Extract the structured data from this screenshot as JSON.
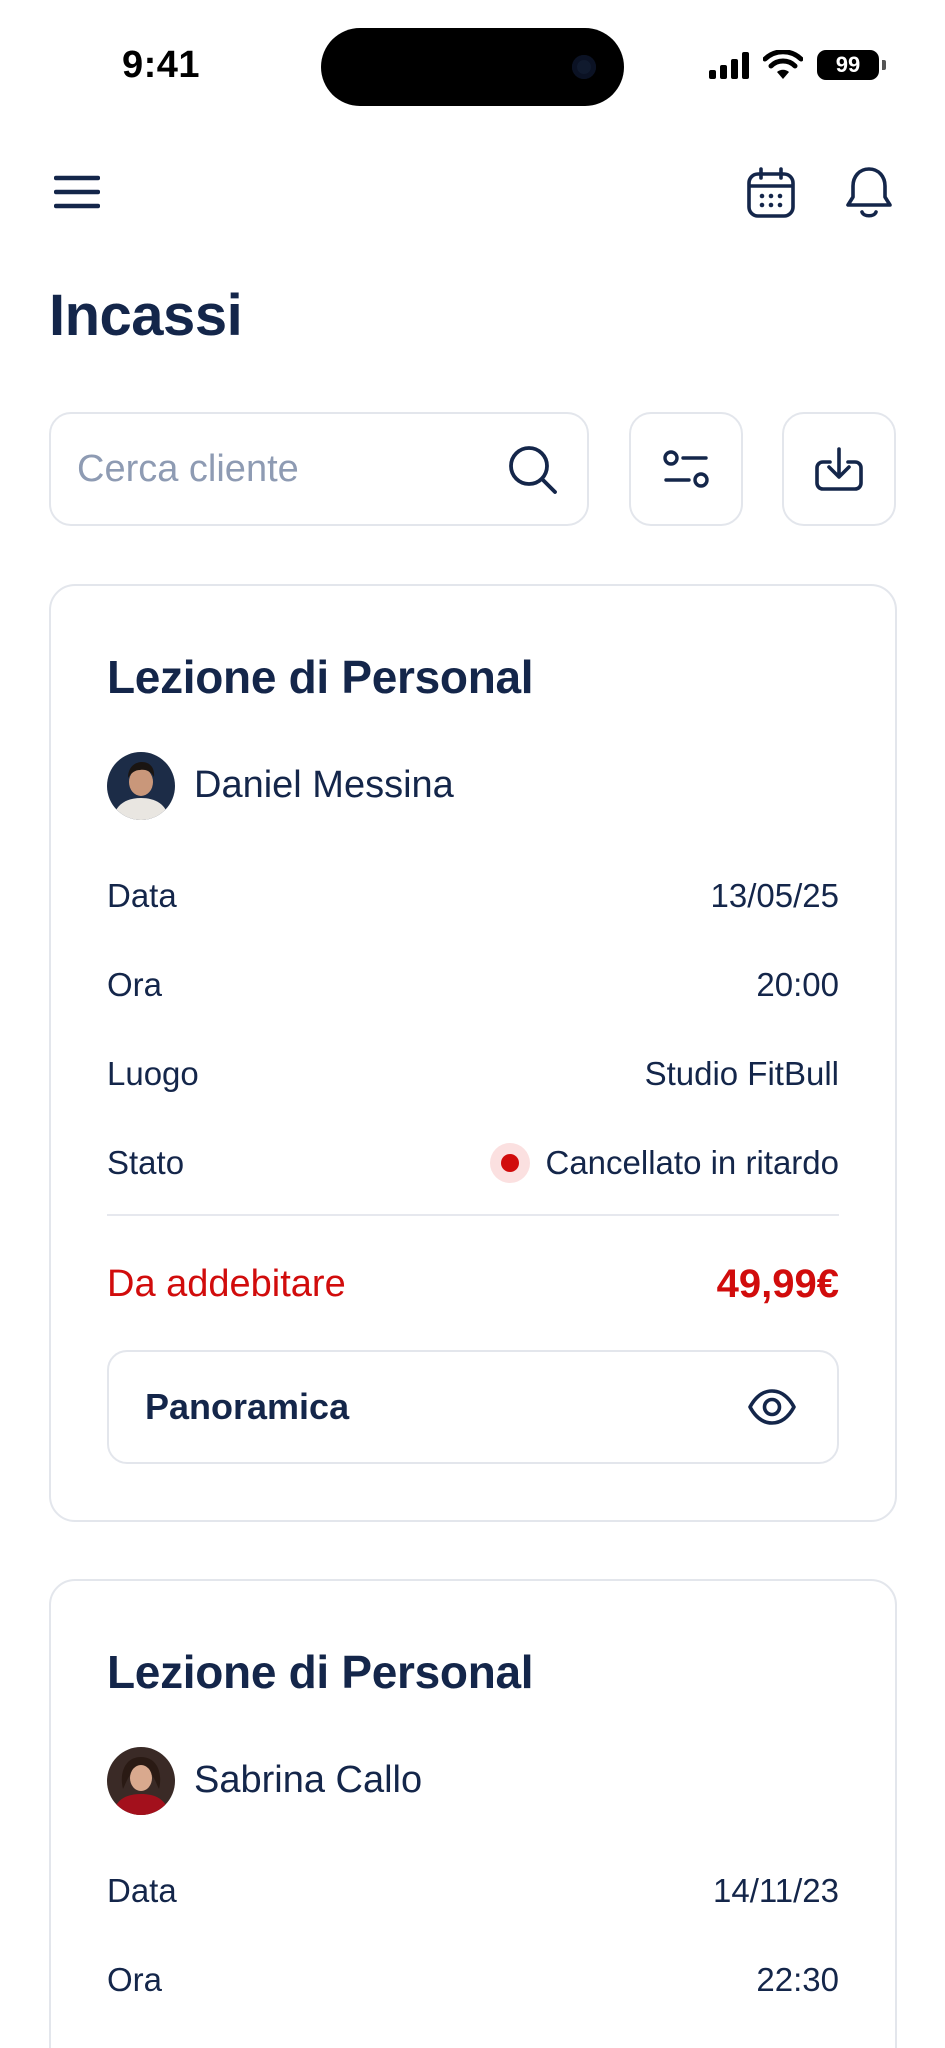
{
  "status_bar": {
    "time": "9:41",
    "battery": "99"
  },
  "header": {
    "title": "Incassi"
  },
  "search": {
    "placeholder": "Cerca cliente"
  },
  "colors": {
    "primary": "#14264a",
    "danger": "#d10c0c",
    "border": "#e3e6ec",
    "muted": "#8e9bb3"
  },
  "icons": {
    "menu": "menu-icon",
    "calendar": "calendar-icon",
    "notifications": "bell-icon",
    "search": "search-icon",
    "filter": "sliders-icon",
    "download": "download-icon",
    "overview": "eye-icon"
  },
  "cards": [
    {
      "title": "Lezione di Personal",
      "client": "Daniel Messina",
      "rows": [
        {
          "label": "Data",
          "value": "13/05/25"
        },
        {
          "label": "Ora",
          "value": "20:00"
        },
        {
          "label": "Luogo",
          "value": "Studio FitBull"
        },
        {
          "label": "Stato",
          "value": "Cancellato in ritardo"
        }
      ],
      "amount_label": "Da addebitare",
      "amount_value": "49,99€",
      "overview_label": "Panoramica"
    },
    {
      "title": "Lezione di Personal",
      "client": "Sabrina Callo",
      "rows": [
        {
          "label": "Data",
          "value": "14/11/23"
        },
        {
          "label": "Ora",
          "value": "22:30"
        }
      ]
    }
  ]
}
